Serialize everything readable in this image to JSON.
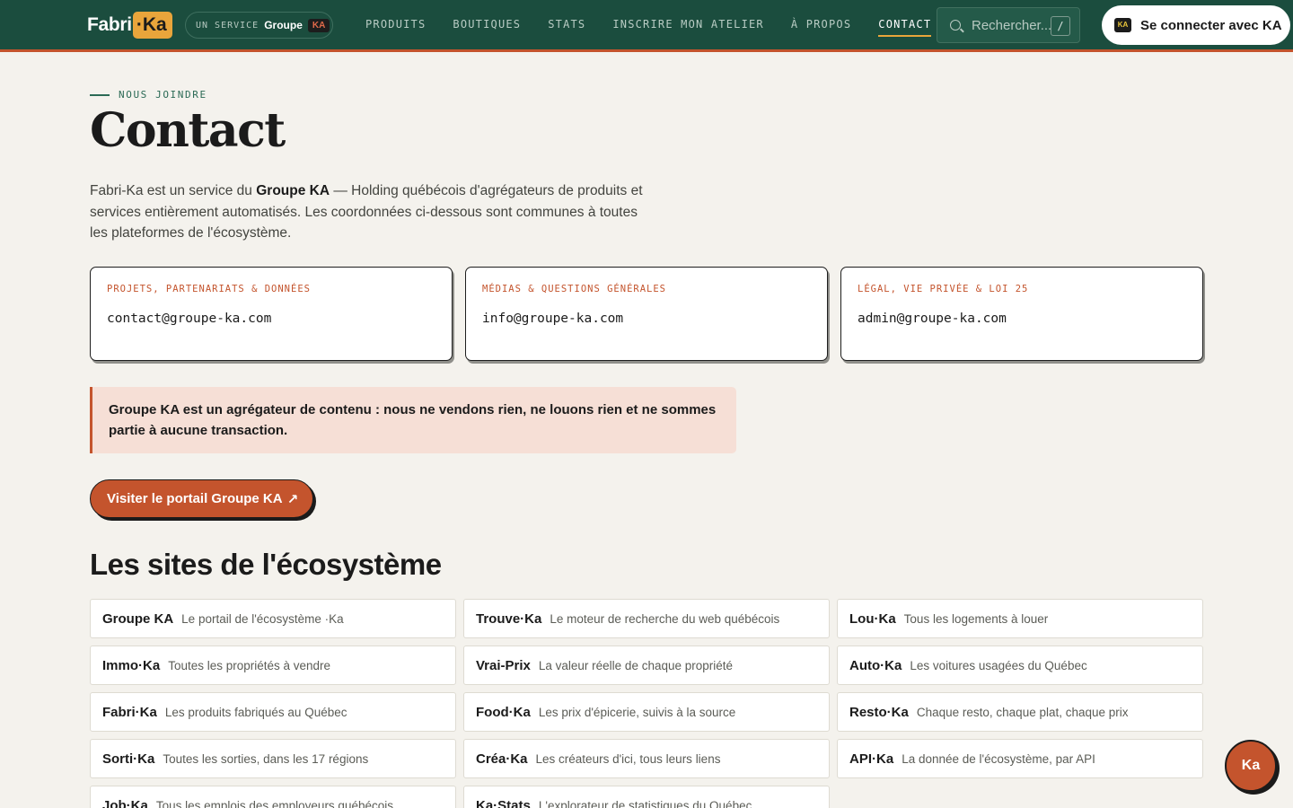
{
  "header": {
    "logo_left": "Fabri",
    "logo_right": "·Ka",
    "service_prefix": "UN SERVICE",
    "service_group": "Groupe",
    "service_badge": "KA",
    "nav": [
      {
        "label": "PRODUITS",
        "active": false
      },
      {
        "label": "BOUTIQUES",
        "active": false
      },
      {
        "label": "STATS",
        "active": false
      },
      {
        "label": "INSCRIRE MON ATELIER",
        "active": false
      },
      {
        "label": "À PROPOS",
        "active": false
      },
      {
        "label": "CONTACT",
        "active": true
      }
    ],
    "search_placeholder": "Rechercher...",
    "search_shortcut": "/",
    "login_badge": "KA",
    "login_label": "Se connecter avec KA"
  },
  "hero": {
    "eyebrow": "NOUS JOINDRE",
    "title": "Contact",
    "intro_1": "Fabri-Ka est un service du ",
    "intro_bold": "Groupe KA",
    "intro_2": " — Holding québécois d'agrégateurs de produits et services entièrement automatisés. Les coordonnées ci-dessous sont communes à toutes les plateformes de l'écosystème."
  },
  "contacts": [
    {
      "label": "PROJETS, PARTENARIATS & DONNÉES",
      "email": "contact@groupe-ka.com"
    },
    {
      "label": "MÉDIAS & QUESTIONS GÉNÉRALES",
      "email": "info@groupe-ka.com"
    },
    {
      "label": "LÉGAL, VIE PRIVÉE & LOI 25",
      "email": "admin@groupe-ka.com"
    }
  ],
  "notice": "Groupe KA est un agrégateur de contenu : nous ne vendons rien, ne louons rien et ne sommes partie à aucune transaction.",
  "portal_button": "Visiter le portail Groupe KA",
  "portal_arrow": "↗",
  "ecosystem_title": "Les sites de l'écosystème",
  "sites": [
    {
      "name": "Groupe KA",
      "desc": "Le portail de l'écosystème ·Ka"
    },
    {
      "name": "Trouve·Ka",
      "desc": "Le moteur de recherche du web québécois"
    },
    {
      "name": "Lou·Ka",
      "desc": "Tous les logements à louer"
    },
    {
      "name": "Immo·Ka",
      "desc": "Toutes les propriétés à vendre"
    },
    {
      "name": "Vrai-Prix",
      "desc": "La valeur réelle de chaque propriété"
    },
    {
      "name": "Auto·Ka",
      "desc": "Les voitures usagées du Québec"
    },
    {
      "name": "Fabri·Ka",
      "desc": "Les produits fabriqués au Québec"
    },
    {
      "name": "Food·Ka",
      "desc": "Les prix d'épicerie, suivis à la source"
    },
    {
      "name": "Resto·Ka",
      "desc": "Chaque resto, chaque plat, chaque prix"
    },
    {
      "name": "Sorti·Ka",
      "desc": "Toutes les sorties, dans les 17 régions"
    },
    {
      "name": "Créa·Ka",
      "desc": "Les créateurs d'ici, tous leurs liens"
    },
    {
      "name": "API·Ka",
      "desc": "La donnée de l'écosystème, par API"
    },
    {
      "name": "Job·Ka",
      "desc": "Tous les emplois des employeurs québécois"
    },
    {
      "name": "Ka·Stats",
      "desc": "L'explorateur de statistiques du Québec"
    }
  ],
  "fab_label": "Ka",
  "colors": {
    "header_bg": "#1b4d3e",
    "accent": "#c4542d",
    "logo_yellow": "#e9a53b",
    "page_bg": "#f4f2ed"
  }
}
